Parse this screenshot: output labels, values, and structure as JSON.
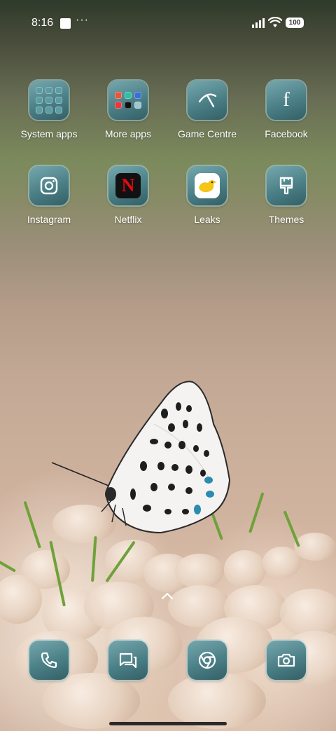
{
  "status_bar": {
    "time": "8:16",
    "overflow": "···",
    "battery": "100",
    "icons": [
      "notification-square-icon",
      "signal-icon",
      "wifi-icon",
      "battery-icon"
    ]
  },
  "home_apps": [
    {
      "label": "System apps",
      "icon": "folder-icon"
    },
    {
      "label": "More apps",
      "icon": "folder-icon"
    },
    {
      "label": "Game Centre",
      "icon": "game-centre-icon"
    },
    {
      "label": "Facebook",
      "icon": "facebook-icon"
    },
    {
      "label": "Instagram",
      "icon": "instagram-icon"
    },
    {
      "label": "Netflix",
      "icon": "netflix-icon"
    },
    {
      "label": "Leaks",
      "icon": "leaks-icon"
    },
    {
      "label": "Themes",
      "icon": "themes-brush-icon"
    }
  ],
  "netflix_letter": "N",
  "facebook_letter": "f",
  "dock": [
    {
      "name": "phone",
      "icon": "phone-icon"
    },
    {
      "name": "messages",
      "icon": "messages-icon"
    },
    {
      "name": "chrome",
      "icon": "chrome-icon"
    },
    {
      "name": "camera",
      "icon": "camera-icon"
    }
  ],
  "colors": {
    "icon_teal": "#4b7f86",
    "icon_ring": "#aad7dc",
    "netflix_red": "#e50914",
    "leaks_yellow": "#f5c518"
  }
}
